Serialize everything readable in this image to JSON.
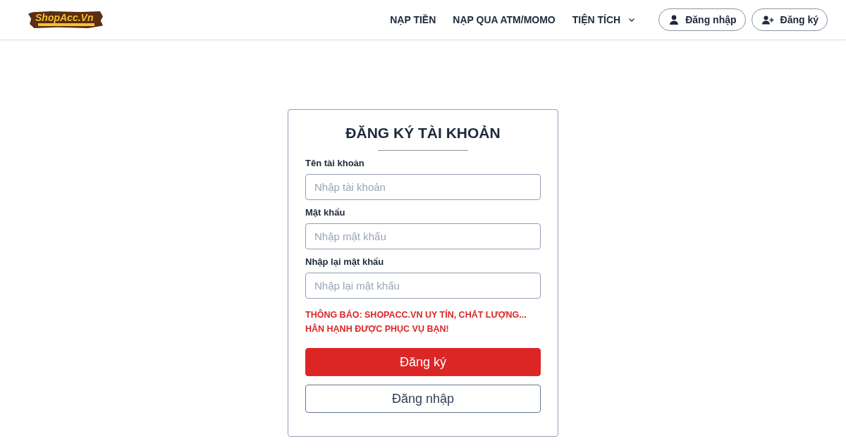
{
  "header": {
    "logo": {
      "text": "ShopAcc.Vn"
    },
    "nav": [
      {
        "label": "NẠP TIỀN",
        "kind": "link"
      },
      {
        "label": "NẠP QUA ATM/MOMO",
        "kind": "link"
      },
      {
        "label": "TIỆN TÍCH",
        "kind": "dropdown"
      }
    ],
    "account_buttons": [
      {
        "label": "Đăng nhập",
        "kind": "login"
      },
      {
        "label": "Đăng ký",
        "kind": "register"
      }
    ]
  },
  "form": {
    "title": "ĐĂNG KÝ TÀI KHOẢN",
    "fields": [
      {
        "label": "Tên tài khoản",
        "placeholder": "Nhập tài khoản"
      },
      {
        "label": "Mật khẩu",
        "placeholder": "Nhập mật khẩu"
      },
      {
        "label": "Nhập lại mật khẩu",
        "placeholder": "Nhập lại mật khẩu"
      }
    ],
    "notice": "THÔNG BÁO: SHOPACC.VN UY TÍN, CHẤT LƯỢNG... HÂN HẠNH ĐƯỢC PHỤC VỤ BẠN!",
    "buttons": [
      {
        "label": "Đăng ký",
        "kind": "primary"
      },
      {
        "label": "Đăng nhập",
        "kind": "outline"
      }
    ]
  }
}
